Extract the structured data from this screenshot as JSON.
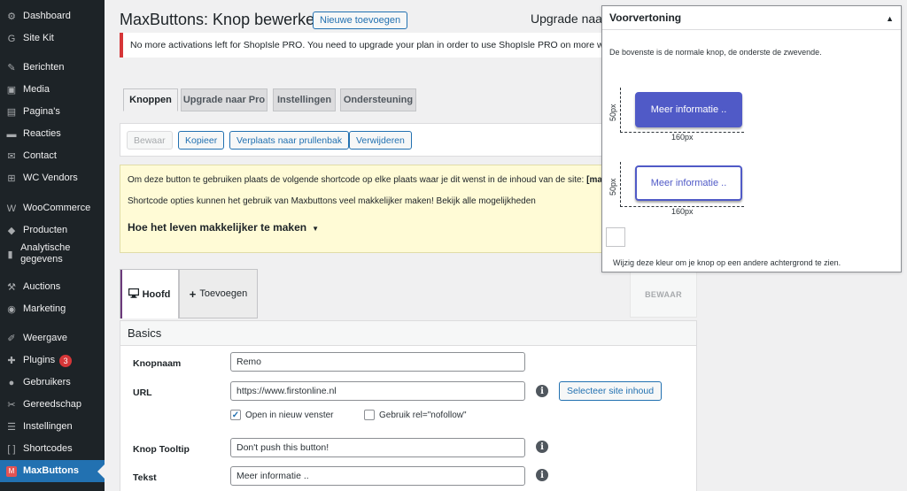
{
  "sidebar": {
    "items": [
      {
        "label": "Dashboard",
        "icon": "dashboard-icon",
        "glyph": "⚙"
      },
      {
        "label": "Site Kit",
        "icon": "sitekit-icon",
        "glyph": "G"
      },
      {
        "label": "Berichten",
        "icon": "pin-icon",
        "glyph": "✎"
      },
      {
        "label": "Media",
        "icon": "media-icon",
        "glyph": "▣"
      },
      {
        "label": "Pagina's",
        "icon": "page-icon",
        "glyph": "▤"
      },
      {
        "label": "Reacties",
        "icon": "comment-icon",
        "glyph": "▬"
      },
      {
        "label": "Contact",
        "icon": "mail-icon",
        "glyph": "✉"
      },
      {
        "label": "WC Vendors",
        "icon": "cart-icon",
        "glyph": "⊞"
      },
      {
        "label": "WooCommerce",
        "icon": "woocommerce-icon",
        "glyph": "W"
      },
      {
        "label": "Producten",
        "icon": "product-icon",
        "glyph": "◆"
      },
      {
        "label": "Analytische gegevens",
        "icon": "chart-icon",
        "glyph": "▮"
      },
      {
        "label": "Auctions",
        "icon": "gavel-icon",
        "glyph": "⚒"
      },
      {
        "label": "Marketing",
        "icon": "megaphone-icon",
        "glyph": "◉"
      },
      {
        "label": "Weergave",
        "icon": "brush-icon",
        "glyph": "✐"
      },
      {
        "label": "Plugins",
        "icon": "plugin-icon",
        "glyph": "✚",
        "badge": "3"
      },
      {
        "label": "Gebruikers",
        "icon": "user-icon",
        "glyph": "●"
      },
      {
        "label": "Gereedschap",
        "icon": "wrench-icon",
        "glyph": "✂"
      },
      {
        "label": "Instellingen",
        "icon": "settings-icon",
        "glyph": "☰"
      },
      {
        "label": "Shortcodes",
        "icon": "brackets-icon",
        "glyph": "[ ]"
      },
      {
        "label": "MaxButtons",
        "icon": "maxbuttons-icon",
        "glyph": "M",
        "active": true
      }
    ]
  },
  "header": {
    "title": "MaxButtons: Knop bewerker",
    "new_button": "Nieuwe toevoegen",
    "upgrade_link": "Upgrade naar"
  },
  "notice": "No more activations left for ShopIsle PRO. You need to upgrade your plan in order to use ShopIsle PRO on more websites.",
  "tabs": [
    "Knoppen",
    "Upgrade naar Pro",
    "Instellingen",
    "Ondersteuning"
  ],
  "actions": {
    "save": "Bewaar",
    "copy": "Kopieer",
    "trash": "Verplaats naar prullenbak",
    "delete": "Verwijderen"
  },
  "shortcode": {
    "line1_text": "Om deze button te gebruiken plaats de volgende shortcode op elke plaats waar je dit wenst in de inhoud van de site: ",
    "line1_code": "[maxbutt",
    "line2": "Shortcode opties kunnen het gebruik van Maxbuttons veel makkelijker maken! Bekijk alle mogelijkheden",
    "toggle": "Hoe het leven makkelijker te maken"
  },
  "editor_tabs": {
    "main": "Hoofd",
    "add": "Toevoegen",
    "save": "BEWAAR"
  },
  "basics": {
    "heading": "Basics",
    "name_label": "Knopnaam",
    "name_value": "Remo",
    "url_label": "URL",
    "url_value": "https://www.firstonline.nl",
    "select_site": "Selecteer site inhoud",
    "new_window": "Open in nieuw venster",
    "new_window_checked": true,
    "nofollow": "Gebruik rel=\"nofollow\"",
    "nofollow_checked": false,
    "tooltip_label": "Knop Tooltip",
    "tooltip_value": "Don't push this button!",
    "text_label": "Tekst",
    "text_value": "Meer informatie .."
  },
  "preview": {
    "title": "Voorvertoning",
    "description": "De bovenste is de normale knop, de onderste de zwevende.",
    "button_text": "Meer informatie ..",
    "height_label": "50px",
    "width_label": "160px",
    "swatch_help": "Wijzig deze kleur om je knop op een andere achtergrond te zien.",
    "button_color": "#505ac7"
  }
}
